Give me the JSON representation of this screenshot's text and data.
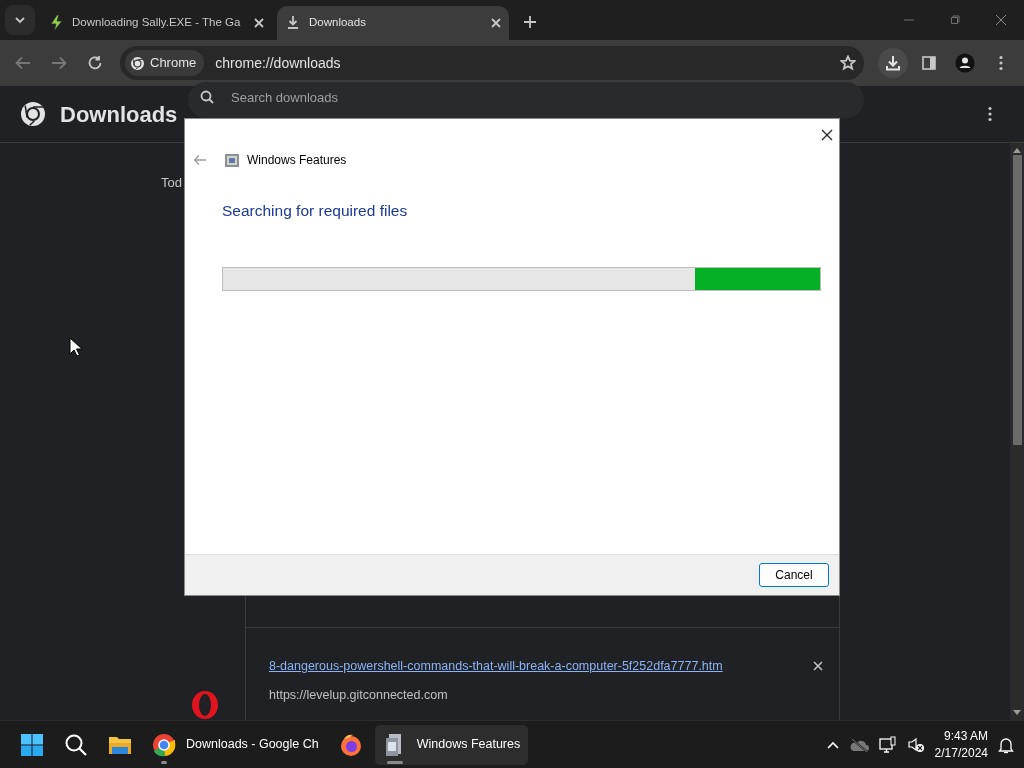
{
  "tab_strip": {
    "tabs": [
      {
        "kind": "site",
        "title": "Downloading Sally.EXE - The Ga",
        "selected": false
      },
      {
        "kind": "downloads",
        "title": "Downloads",
        "selected": true
      }
    ]
  },
  "toolbar": {
    "site_chip": "Chrome",
    "url": "chrome://downloads"
  },
  "page": {
    "title": "Downloads",
    "search": {
      "placeholder": "Search downloads"
    },
    "date_label": "Tod",
    "items": [
      {
        "file_name": "8-dangerous-powershell-commands-that-will-break-a-computer-5f252dfa7777.htm",
        "source": "https://levelup.gitconnected.com"
      }
    ]
  },
  "dialog": {
    "title": "Windows Features",
    "heading": "Searching for required files",
    "progress": {
      "level": 0.21
    },
    "buttons": [
      "Cancel"
    ]
  },
  "taskbar": {
    "apps": [
      {
        "kind": "start",
        "selected": false,
        "running": false
      },
      {
        "kind": "search",
        "selected": false,
        "running": false
      },
      {
        "kind": "explorer",
        "selected": false,
        "running": false
      },
      {
        "kind": "chrome",
        "label": "Downloads - Google Ch",
        "selected": false,
        "running": true
      },
      {
        "kind": "firefox",
        "selected": false,
        "running": false
      },
      {
        "kind": "features",
        "label": "Windows Features",
        "selected": true,
        "running": true
      }
    ],
    "clock": {
      "time": "9:43 AM",
      "date": "2/17/2024"
    }
  }
}
